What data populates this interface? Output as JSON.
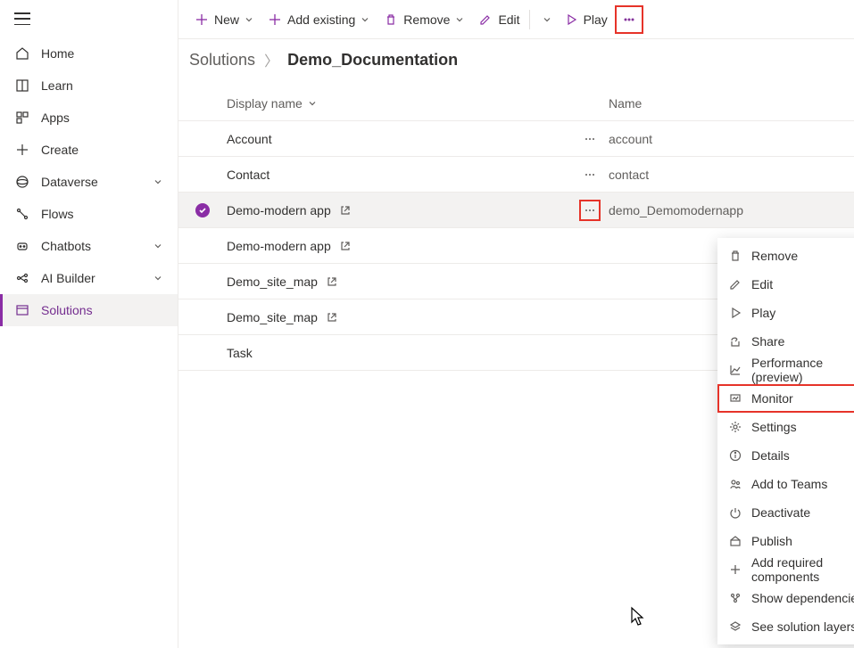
{
  "sidebar": {
    "items": [
      {
        "label": "Home"
      },
      {
        "label": "Learn"
      },
      {
        "label": "Apps"
      },
      {
        "label": "Create"
      },
      {
        "label": "Dataverse"
      },
      {
        "label": "Flows"
      },
      {
        "label": "Chatbots"
      },
      {
        "label": "AI Builder"
      },
      {
        "label": "Solutions"
      }
    ]
  },
  "commands": {
    "new": "New",
    "add_existing": "Add existing",
    "remove": "Remove",
    "edit": "Edit",
    "play": "Play"
  },
  "breadcrumb": {
    "root": "Solutions",
    "current": "Demo_Documentation"
  },
  "table": {
    "headers": {
      "display": "Display name",
      "name": "Name"
    },
    "rows": [
      {
        "display": "Account",
        "name": "account",
        "ext": false,
        "dots": true
      },
      {
        "display": "Contact",
        "name": "contact",
        "ext": false,
        "dots": true
      },
      {
        "display": "Demo-modern app",
        "name": "demo_Demomodernapp",
        "ext": true,
        "dots": true,
        "selected": true
      },
      {
        "display": "Demo-modern app",
        "name": "",
        "ext": true,
        "dots": false
      },
      {
        "display": "Demo_site_map",
        "name": "",
        "ext": true,
        "dots": false
      },
      {
        "display": "Demo_site_map",
        "name": "",
        "ext": true,
        "dots": false
      },
      {
        "display": "Task",
        "name": "",
        "ext": false,
        "dots": false
      }
    ]
  },
  "context_menu": {
    "items": [
      {
        "label": "Remove",
        "icon": "trash",
        "sub": true
      },
      {
        "label": "Edit",
        "icon": "pencil",
        "sub": true,
        "split": true
      },
      {
        "label": "Play",
        "icon": "play"
      },
      {
        "label": "Share",
        "icon": "share"
      },
      {
        "label": "Performance (preview)",
        "icon": "chart"
      },
      {
        "label": "Monitor",
        "icon": "monitor",
        "highlight": true
      },
      {
        "label": "Settings",
        "icon": "gear"
      },
      {
        "label": "Details",
        "icon": "info"
      },
      {
        "label": "Add to Teams",
        "icon": "teams"
      },
      {
        "label": "Deactivate",
        "icon": "power"
      },
      {
        "label": "Publish",
        "icon": "publish"
      },
      {
        "label": "Add required components",
        "icon": "plus"
      },
      {
        "label": "Show dependencies",
        "icon": "deps"
      },
      {
        "label": "See solution layers",
        "icon": "layers"
      }
    ]
  }
}
